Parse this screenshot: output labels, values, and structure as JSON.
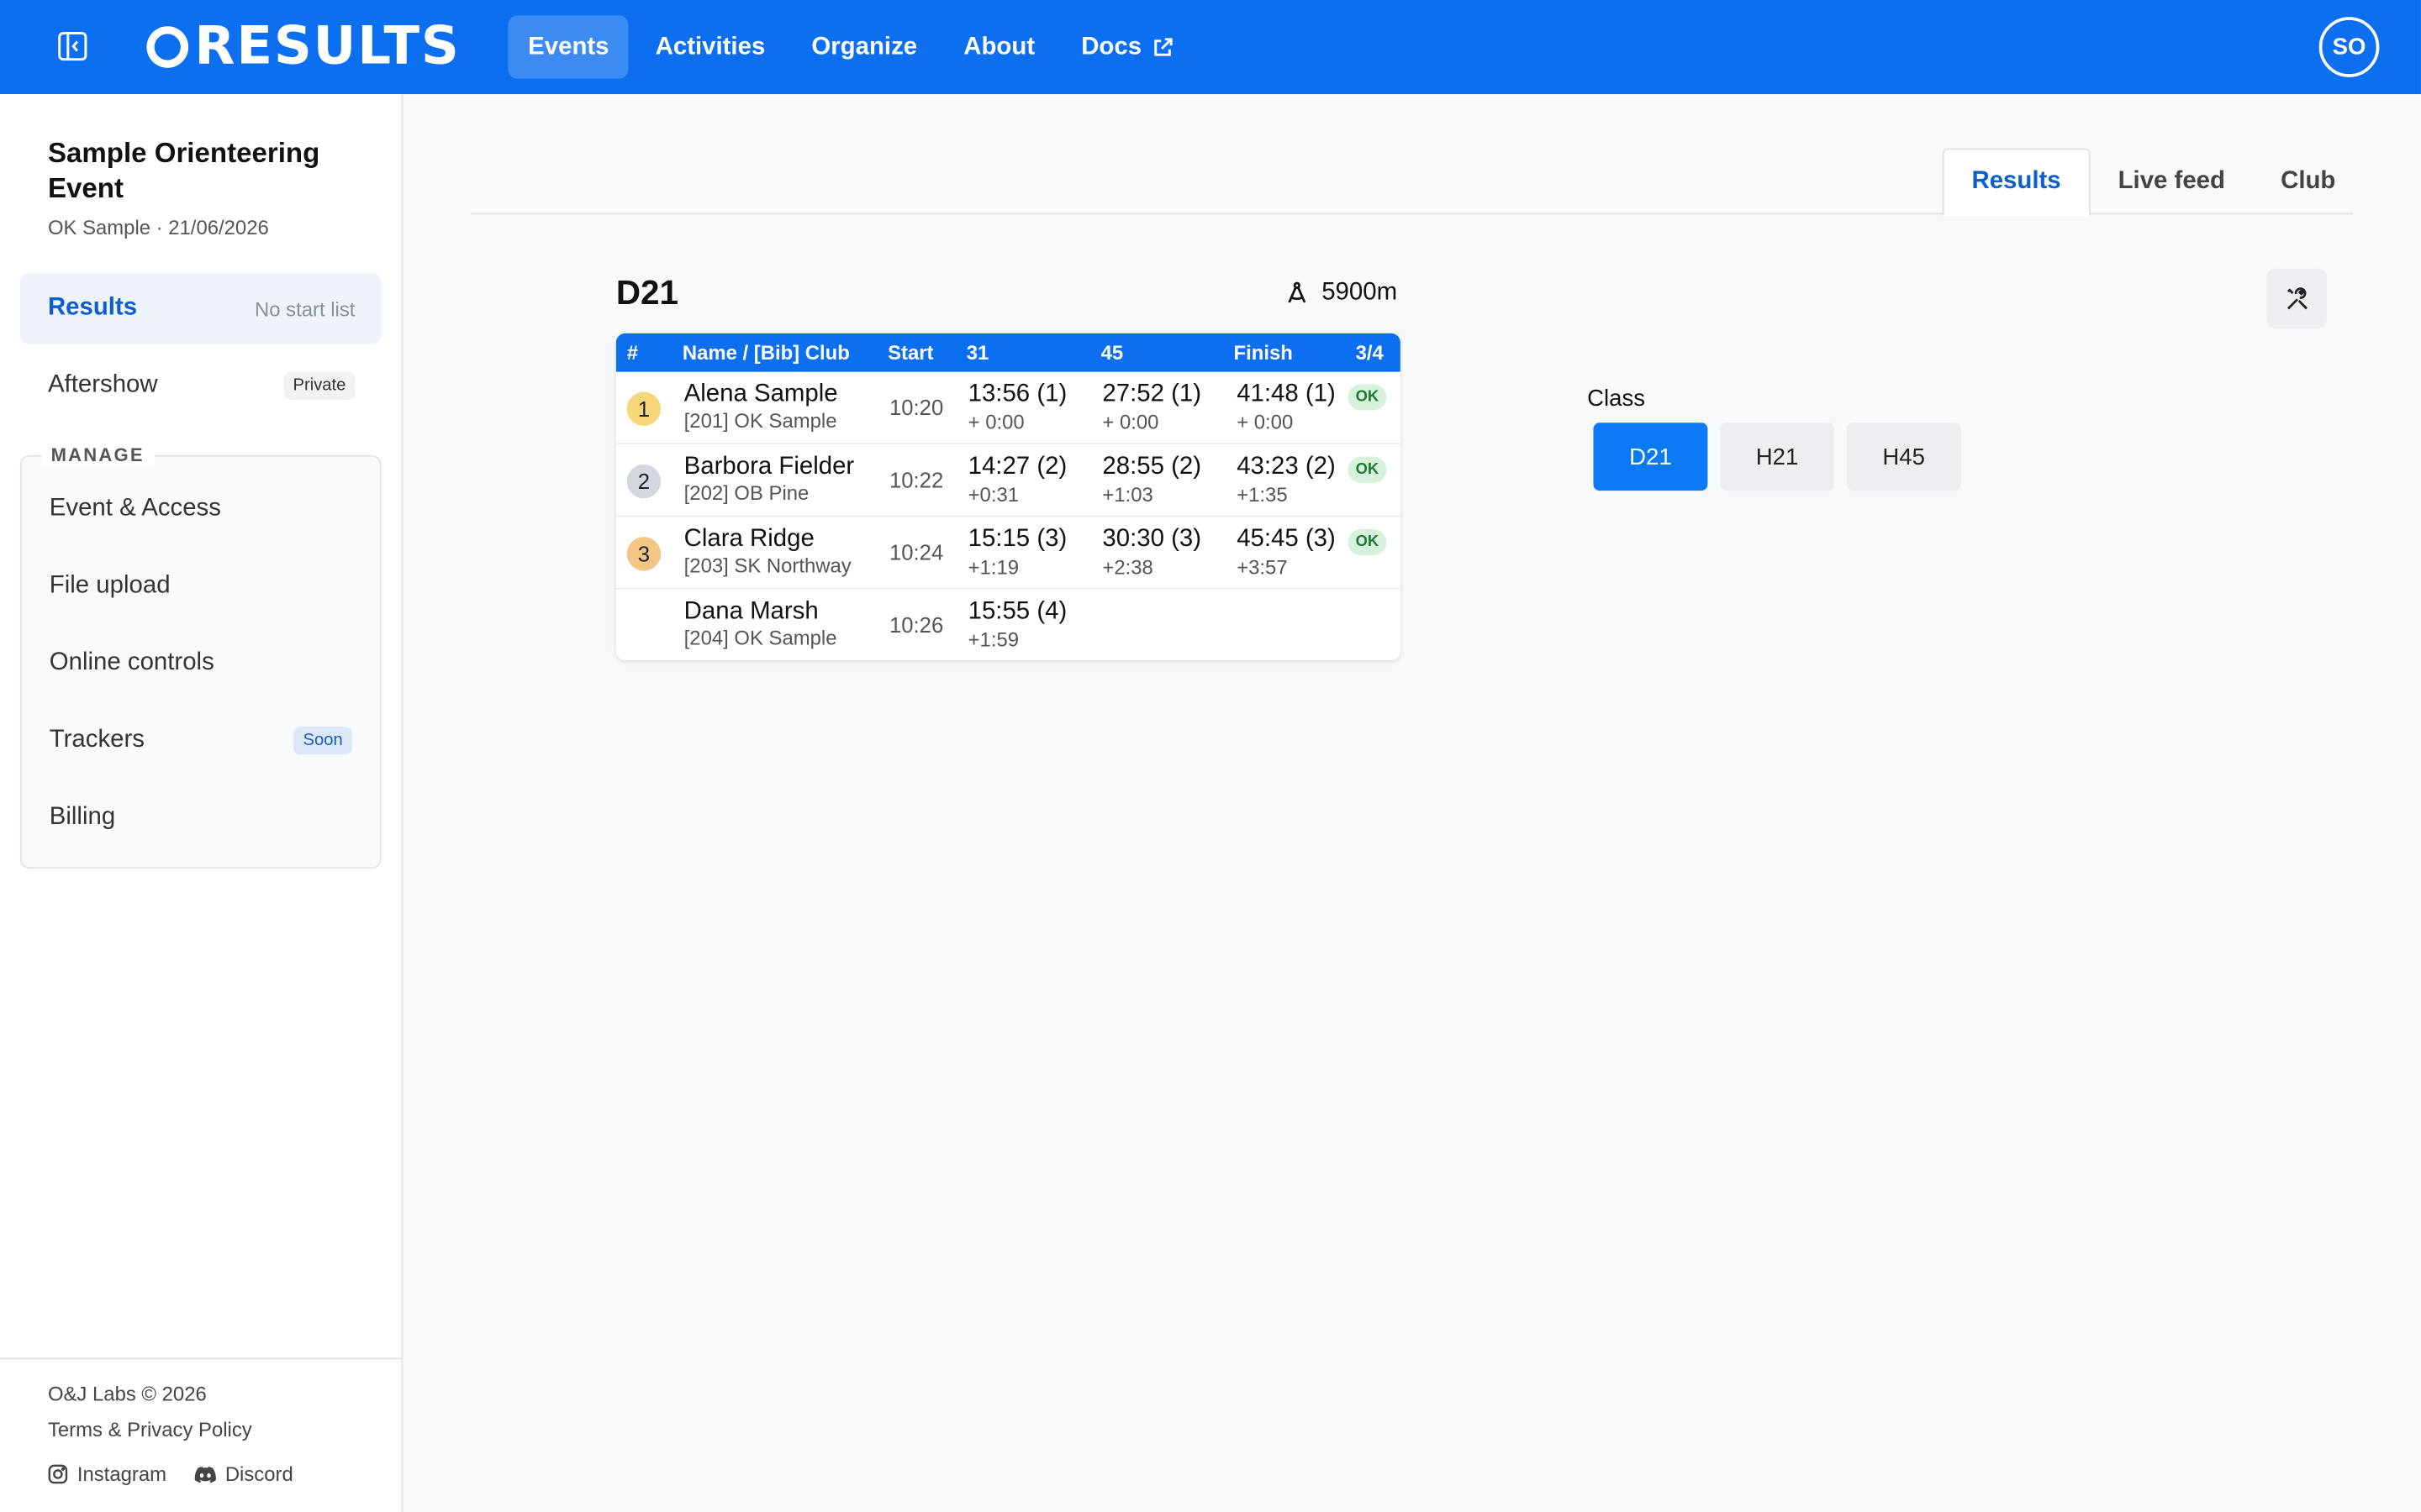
{
  "header": {
    "logo_text": "RESULTS",
    "nav": [
      {
        "label": "Events",
        "active": true
      },
      {
        "label": "Activities",
        "active": false
      },
      {
        "label": "Organize",
        "active": false
      },
      {
        "label": "About",
        "active": false
      },
      {
        "label": "Docs",
        "active": false,
        "external": true
      }
    ],
    "avatar_initials": "SO"
  },
  "sidebar": {
    "event_title": "Sample Orienteering Event",
    "event_subtitle": "OK Sample · 21/06/2026",
    "items": [
      {
        "label": "Results",
        "note": "No start list",
        "active": true
      },
      {
        "label": "Aftershow",
        "badge": "Private"
      }
    ],
    "manage_label": "MANAGE",
    "manage_items": [
      {
        "label": "Event & Access"
      },
      {
        "label": "File upload"
      },
      {
        "label": "Online controls"
      },
      {
        "label": "Trackers",
        "badge": "Soon"
      },
      {
        "label": "Billing"
      }
    ],
    "footer": {
      "copyright": "O&J Labs © 2026",
      "terms": "Terms & Privacy Policy",
      "instagram": "Instagram",
      "discord": "Discord"
    }
  },
  "tabs": [
    {
      "label": "Results",
      "active": true
    },
    {
      "label": "Live feed",
      "active": false
    },
    {
      "label": "Club",
      "active": false
    }
  ],
  "results": {
    "class_name": "D21",
    "course_length": "5900m",
    "headers": {
      "rank": "#",
      "name": "Name / [Bib] Club",
      "start": "Start",
      "c1": "31",
      "c2": "45",
      "finish": "Finish",
      "progress": "3/4"
    },
    "rows": [
      {
        "rank": "1",
        "name": "Alena Sample",
        "club": "[201] OK Sample",
        "start": "10:20",
        "c1": "13:56 (1)",
        "c1d": "+ 0:00",
        "c2": "27:52 (1)",
        "c2d": "+ 0:00",
        "finish": "41:48 (1)",
        "fd": "+ 0:00",
        "status": "OK"
      },
      {
        "rank": "2",
        "name": "Barbora Fielder",
        "club": "[202] OB Pine",
        "start": "10:22",
        "c1": "14:27 (2)",
        "c1d": "+0:31",
        "c2": "28:55 (2)",
        "c2d": "+1:03",
        "finish": "43:23 (2)",
        "fd": "+1:35",
        "status": "OK"
      },
      {
        "rank": "3",
        "name": "Clara Ridge",
        "club": "[203] SK Northway",
        "start": "10:24",
        "c1": "15:15 (3)",
        "c1d": "+1:19",
        "c2": "30:30 (3)",
        "c2d": "+2:38",
        "finish": "45:45 (3)",
        "fd": "+3:57",
        "status": "OK"
      },
      {
        "rank": "",
        "name": "Dana Marsh",
        "club": "[204] OK Sample",
        "start": "10:26",
        "c1": "15:55 (4)",
        "c1d": "+1:59",
        "c2": "",
        "c2d": "",
        "finish": "",
        "fd": "",
        "status": ""
      }
    ],
    "rank_colors": {
      "1": "#f8d77a",
      "2": "#d3d8de",
      "3": "#f3c686"
    }
  },
  "class_selector": {
    "label": "Class",
    "options": [
      {
        "label": "D21",
        "active": true
      },
      {
        "label": "H21",
        "active": false
      },
      {
        "label": "H45",
        "active": false
      }
    ]
  }
}
